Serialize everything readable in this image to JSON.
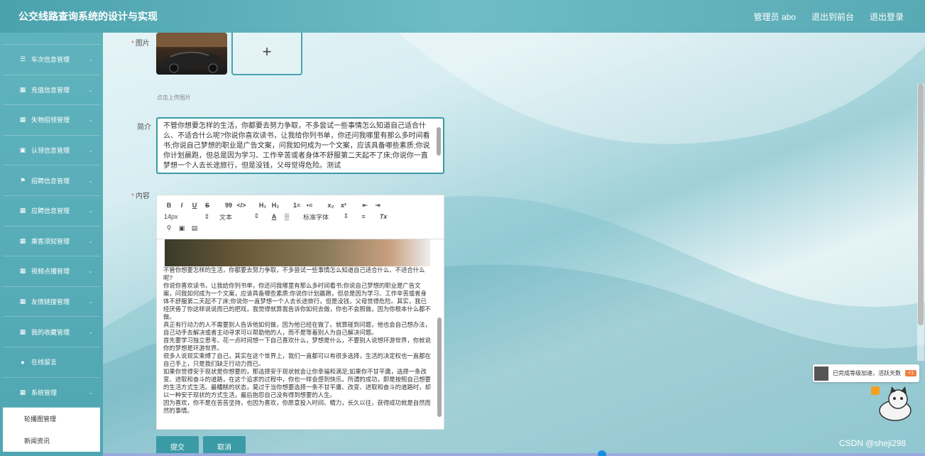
{
  "app": {
    "title": "公交线路查询系统的设计与实现"
  },
  "header": {
    "user": "管理员 abo",
    "to_front": "退出到前台",
    "logout": "退出登录"
  },
  "sidebar": {
    "items": [
      {
        "label": "车次信息管理",
        "icon": "list-icon"
      },
      {
        "label": "充值信息管理",
        "icon": "grid-icon"
      },
      {
        "label": "失物招领管理",
        "icon": "grid-icon"
      },
      {
        "label": "认领信息管理",
        "icon": "person-icon"
      },
      {
        "label": "招聘信息管理",
        "icon": "flag-icon"
      },
      {
        "label": "应聘信息管理",
        "icon": "grid-icon"
      },
      {
        "label": "乘客须知管理",
        "icon": "grid-icon"
      },
      {
        "label": "视频点播管理",
        "icon": "grid-icon"
      },
      {
        "label": "友情链接管理",
        "icon": "grid-icon"
      },
      {
        "label": "我的收藏管理",
        "icon": "grid-icon"
      },
      {
        "label": "在线留言",
        "icon": "pin-icon"
      },
      {
        "label": "系统管理",
        "icon": "grid-icon"
      }
    ],
    "submenu": [
      "轮播图管理",
      "新闻资讯"
    ]
  },
  "form": {
    "image_label": "图片",
    "upload_plus": "+",
    "upload_hint": "点击上传图片",
    "intro_label": "简介",
    "intro_text": "不管你想要怎样的生活，你都要去努力争取，不多尝试一些事情怎么知道自己适合什么、不适合什么呢?你说你喜欢读书，让我给你列书单，你还问我哪里有那么多时间看书;你说自己梦想的职业是广告文案，问我如何成为一个文案，应该具备哪些素质;你说你计划晨跑，但总是因为学习、工作辛苦或者身体不舒服第二天起不了床;你说你一直梦想一个人去长途旅行，但是没钱，父母觉得危险。测试",
    "content_label": "内容",
    "toolbar": {
      "bold": "B",
      "italic": "I",
      "underline": "U",
      "strike": "S",
      "quote": "99",
      "code": "</>",
      "h1": "H₁",
      "h2": "H₂",
      "ol": "1≡",
      "ul": "•≡",
      "sub": "x₂",
      "sup": "x²",
      "outdent": "⇤",
      "indent": "⇥",
      "size": "14px",
      "text": "文本",
      "color": "A",
      "bg": "▒",
      "font": "标准字体",
      "align": "≡",
      "clear": "Tx",
      "link": "🔗",
      "image": "▣",
      "video": "▤"
    },
    "content_text": [
      "不管你想要怎样的生活，你都要去努力争取，不多尝试一些事情怎么知道自己适合什么、不适合什么呢?",
      "你说你喜欢读书，让我给你列书单，你还问我哪里有那么多时间看书;你说自己梦想的职业是广告文案，问我如何成为一个文案，应该具备哪些素质;你说你计划晨跑，但总是因为学习、工作辛苦或者身体不舒服第二天起不了床;你说你一直梦想一个人去长途旅行，但是没钱，父母觉得危险。其实，我已经厌倦了你这样说说而已的把戏，我觉得就算我告诉你如何去做，你也不会照做，因为你根本什么都不做。",
      "真正有行动力的人不需要别人告诉他如何做，因为他已经在做了。就算碰到问题，他也会自己想办法，自己动手去解决或者主动寻求可以帮助他的人，而不是等着别人为自己解决问题。",
      "首先要学习独立思考。花一点时间想一下自己喜欢什么，梦想是什么，不要别人说想环游世界，你就说你的梦想是环游世界。",
      "很多人说现实束缚了自己，其实在这个世界上，我们一直都可以有很多选择，生活的决定权也一直都在自己手上，只是我们缺乏行动力而已。",
      "如果你觉得安于现状是你想要的，那选择安于现状就会让你幸福和满足;如果你不甘平庸，选择一条改变、进取和奋斗的道路，在这个追求的过程中，你也一样会感到快乐。所谓的成功，即是按照自己想要的生活方式生活。最糟糕的状态，莫过于当你想要选择一条不甘平庸、改变、进取和奋斗的道路时，却以一种安于现状的方式生活，最后抱怨自己没有得到想要的人生。",
      "因为喜欢，你不是在苦苦坚持，也因为喜欢，你愿意投入时间、精力，长久以往，获得成功就是自然而然的事情。"
    ],
    "submit": "提交",
    "cancel": "取消"
  },
  "notice": {
    "text": "已完成等级加速，活跃天数",
    "badge": "+1"
  },
  "watermark": "CSDN @sheji298"
}
